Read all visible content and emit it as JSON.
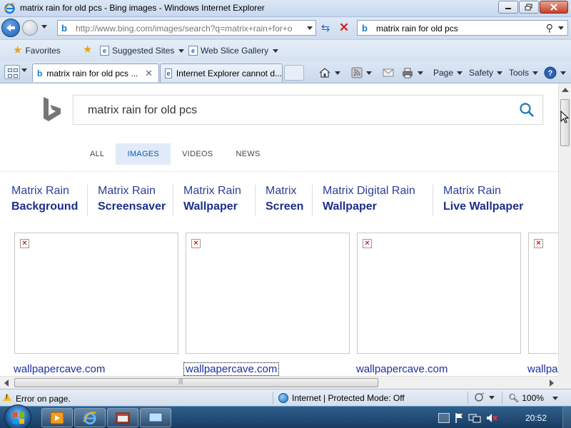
{
  "window": {
    "title": "matrix rain for old pcs - Bing images - Windows Internet Explorer"
  },
  "address_bar": {
    "url": "http://www.bing.com/images/search?q=matrix+rain+for+o"
  },
  "search_box": {
    "value": "matrix rain for old pcs"
  },
  "favorites_bar": {
    "favorites_label": "Favorites",
    "suggested_sites_label": "Suggested Sites",
    "web_slice_label": "Web Slice Gallery"
  },
  "tabs": [
    {
      "label": "matrix rain for old pcs ...",
      "active": true
    },
    {
      "label": "Internet Explorer cannot d...",
      "active": false
    }
  ],
  "command_bar": {
    "page_label": "Page",
    "safety_label": "Safety",
    "tools_label": "Tools"
  },
  "bing": {
    "query": "matrix rain for old pcs",
    "scopes": [
      {
        "label": "ALL",
        "active": false
      },
      {
        "label": "IMAGES",
        "active": true
      },
      {
        "label": "VIDEOS",
        "active": false
      },
      {
        "label": "NEWS",
        "active": false
      }
    ],
    "related": [
      {
        "line1": "Matrix Rain",
        "line2": "Background"
      },
      {
        "line1": "Matrix Rain",
        "line2": "Screensaver"
      },
      {
        "line1": "Matrix Rain",
        "line2": "Wallpaper"
      },
      {
        "line1": "Matrix",
        "line2": "Screen"
      },
      {
        "line1": "Matrix Digital Rain",
        "line2": "Wallpaper"
      },
      {
        "line1": "Matrix Rain",
        "line2": "Live Wallpaper"
      }
    ],
    "results": [
      {
        "source": "wallpapercave.com"
      },
      {
        "source": "wallpapercave.com"
      },
      {
        "source": "wallpapercave.com"
      },
      {
        "source": "wallpa"
      }
    ]
  },
  "status_bar": {
    "message": "Error on page.",
    "zone": "Internet | Protected Mode: Off",
    "zoom": "100%"
  },
  "taskbar": {
    "clock": "20:52"
  },
  "colors": {
    "link": "#1a2fa0",
    "scope_active": "#0c57b8",
    "bing_logo": "#767676"
  }
}
